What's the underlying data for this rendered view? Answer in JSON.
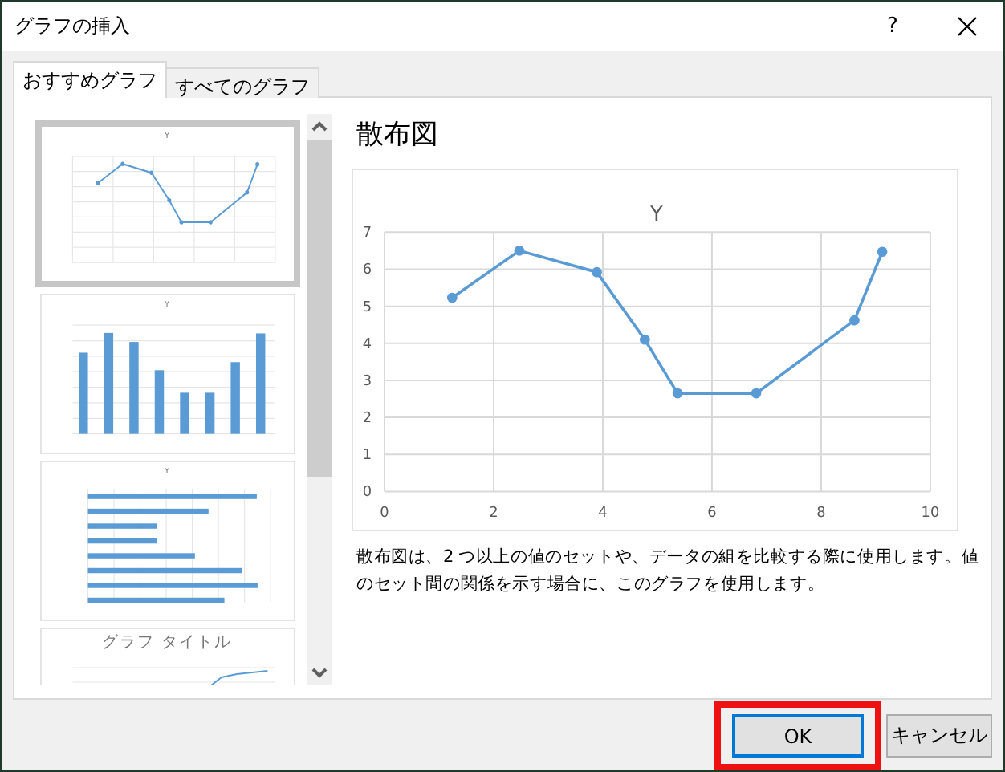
{
  "window": {
    "title": "グラフの挿入",
    "help": "?"
  },
  "tabs": [
    {
      "label": "おすすめグラフ",
      "selected": true
    },
    {
      "label": "すべてのグラフ",
      "selected": false
    }
  ],
  "thumbnails": [
    {
      "kind": "scatter",
      "title": "Y",
      "selected": true
    },
    {
      "kind": "column",
      "title": "Y",
      "selected": false
    },
    {
      "kind": "bar",
      "title": "Y",
      "selected": false
    },
    {
      "kind": "line",
      "title": "グラフ タイトル",
      "selected": false
    }
  ],
  "preview": {
    "heading": "散布図",
    "description": "散布図は、2 つ以上の値のセットや、データの組を比較する際に使用します。値のセット間の関係を示す場合に、このグラフを使用します。",
    "chart_data": {
      "type": "line",
      "grid": true,
      "x": [
        1.24,
        2.47,
        3.89,
        4.77,
        5.37,
        6.81,
        8.61,
        9.12
      ],
      "series": [
        {
          "name": "Y",
          "color": "#5b9bd5",
          "marker": true,
          "values": [
            5.23,
            6.5,
            5.92,
            4.1,
            2.65,
            2.65,
            4.62,
            6.47
          ]
        }
      ],
      "xlim": [
        0,
        10
      ],
      "ylim": [
        0,
        7
      ],
      "xticks": [
        0,
        2,
        4,
        6,
        8,
        10
      ],
      "yticks": [
        0,
        1,
        2,
        3,
        4,
        5,
        6,
        7
      ]
    }
  },
  "buttons": [
    {
      "label": "OK",
      "default": true,
      "highlighted": true
    },
    {
      "label": "キャンセル",
      "default": false,
      "highlighted": false
    }
  ]
}
